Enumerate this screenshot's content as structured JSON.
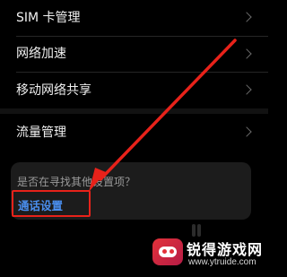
{
  "menu": {
    "items": [
      {
        "label": "SIM 卡管理"
      },
      {
        "label": "网络加速"
      },
      {
        "label": "移动网络共享"
      },
      {
        "label": "流量管理"
      }
    ]
  },
  "hint": {
    "question": "是否在寻找其他设置项？",
    "link": "通话设置"
  },
  "watermark": {
    "title": "锐得游戏网",
    "url": "www.ytruide.com"
  },
  "colors": {
    "background": "#000000",
    "link": "#4a8ff0",
    "highlight": "#e8221a",
    "arrow": "#e8221a"
  }
}
